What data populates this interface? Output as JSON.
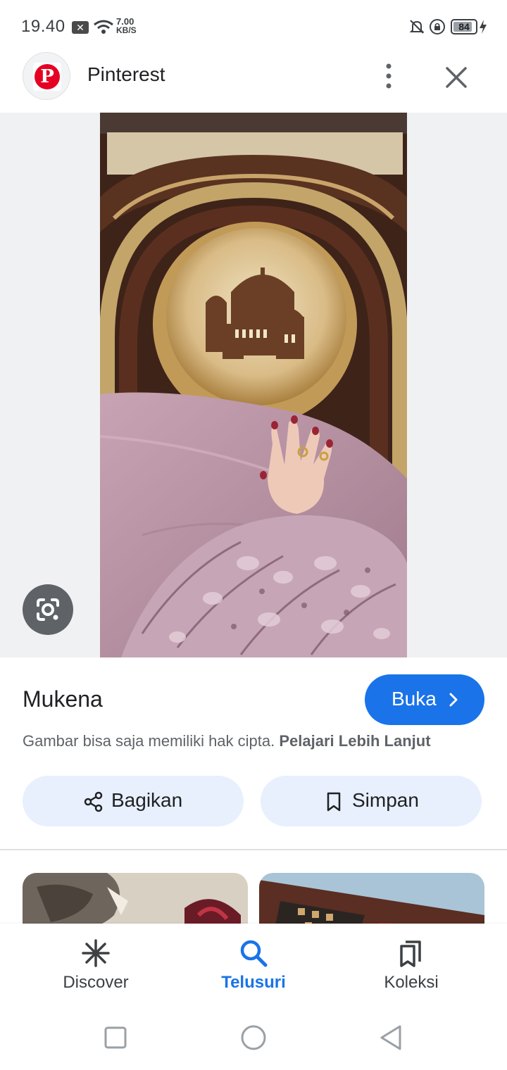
{
  "status_bar": {
    "time": "19.40",
    "net_speed_value": "7.00",
    "net_speed_unit": "KB/S",
    "battery": "84"
  },
  "header": {
    "site_name": "Pinterest"
  },
  "result": {
    "title": "Mukena",
    "open_label": "Buka",
    "copyright_note": "Gambar bisa saja memiliki hak cipta.",
    "learn_more": "Pelajari Lebih Lanjut",
    "share_label": "Bagikan",
    "save_label": "Simpan"
  },
  "bottom_nav": {
    "items": [
      {
        "label": "Discover",
        "icon": "asterisk-icon",
        "active": false
      },
      {
        "label": "Telusuri",
        "icon": "search-icon",
        "active": true
      },
      {
        "label": "Koleksi",
        "icon": "collections-icon",
        "active": false
      }
    ]
  },
  "colors": {
    "accent": "#1a73e8",
    "pill_bg": "#e8f0fe",
    "pinterest_red": "#e60023"
  }
}
